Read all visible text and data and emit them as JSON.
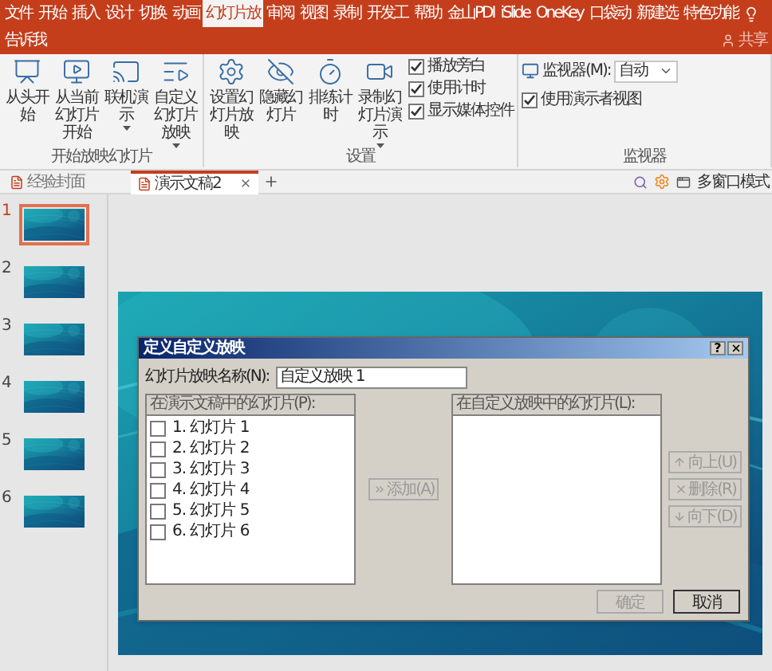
{
  "menu_tabs": [
    {
      "label": "文件",
      "selected": false
    },
    {
      "label": "开始",
      "selected": false
    },
    {
      "label": "插入",
      "selected": false
    },
    {
      "label": "设计",
      "selected": false
    },
    {
      "label": "切换",
      "selected": false
    },
    {
      "label": "动画",
      "selected": false
    },
    {
      "label": "幻灯片放",
      "selected": true
    },
    {
      "label": "审阅",
      "selected": false
    },
    {
      "label": "视图",
      "selected": false
    },
    {
      "label": "录制",
      "selected": false
    },
    {
      "label": "开发工",
      "selected": false
    },
    {
      "label": "帮助",
      "selected": false
    },
    {
      "label": "金山PDI",
      "selected": false
    },
    {
      "label": "iSlide",
      "selected": false
    },
    {
      "label": "OneKey",
      "selected": false
    },
    {
      "label": "口袋动",
      "selected": false
    },
    {
      "label": "新建选",
      "selected": false
    },
    {
      "label": "特色功能",
      "selected": false
    }
  ],
  "tell_me": "告诉我",
  "share": "共享",
  "ribbon_groups": [
    {
      "label": "开始放映幻灯片",
      "items": [
        {
          "kind": "button",
          "label": "从头开始",
          "dropdown": false
        },
        {
          "kind": "button",
          "label": "从当前幻灯片开始",
          "dropdown": false
        },
        {
          "kind": "button",
          "label": "联机演示",
          "dropdown": true
        },
        {
          "kind": "button",
          "label": "自定义幻灯片放映",
          "dropdown": true
        }
      ]
    },
    {
      "label": "设置",
      "items": [
        {
          "kind": "button",
          "label": "设置幻灯片放映",
          "dropdown": false
        },
        {
          "kind": "button",
          "label": "隐藏幻灯片",
          "dropdown": false
        },
        {
          "kind": "button",
          "label": "排练计时",
          "dropdown": false
        },
        {
          "kind": "button",
          "label": "录制幻灯片演示",
          "dropdown": true
        },
        {
          "kind": "checks",
          "options": [
            {
              "label": "播放旁白",
              "checked": true
            },
            {
              "label": "使用计时",
              "checked": true
            },
            {
              "label": "显示媒体控件",
              "checked": true
            }
          ]
        }
      ]
    },
    {
      "label": "监视器",
      "items": [
        {
          "kind": "select",
          "label": "监视器(M):",
          "value": "自动"
        },
        {
          "kind": "checkbox",
          "label": "使用演示者视图",
          "checked": true
        }
      ]
    }
  ],
  "doc_tabs": [
    {
      "label": "经验封面",
      "selected": false
    },
    {
      "label": "演示文稿2",
      "selected": true
    }
  ],
  "window_mode": "多窗口模式",
  "slides": [
    {
      "number": "1",
      "selected": true
    },
    {
      "number": "2",
      "selected": false
    },
    {
      "number": "3",
      "selected": false
    },
    {
      "number": "4",
      "selected": false
    },
    {
      "number": "5",
      "selected": false
    },
    {
      "number": "6",
      "selected": false
    }
  ],
  "dialog": {
    "title": "定义自定义放映",
    "help": "?",
    "name_label": "幻灯片放映名称(N):",
    "name_value": "自定义放映 1",
    "available": {
      "header": "在演示文稿中的幻灯片(P):",
      "items": [
        {
          "label": "1. 幻灯片 1",
          "checked": false
        },
        {
          "label": "2. 幻灯片 2",
          "checked": false
        },
        {
          "label": "3. 幻灯片 3",
          "checked": false
        },
        {
          "label": "4. 幻灯片 4",
          "checked": false
        },
        {
          "label": "5. 幻灯片 5",
          "checked": false
        },
        {
          "label": "6. 幻灯片 6",
          "checked": false
        }
      ]
    },
    "add_button": {
      "label": "添加(A)",
      "disabled": true
    },
    "custom": {
      "header": "在自定义放映中的幻灯片(L):"
    },
    "move_buttons": [
      {
        "kind": "up",
        "label": "向上(U)",
        "disabled": true
      },
      {
        "kind": "delete",
        "label": "删除(R)",
        "disabled": true
      },
      {
        "kind": "down",
        "label": "向下(D)",
        "disabled": true
      }
    ],
    "ok": {
      "label": "确定",
      "disabled": true
    },
    "cancel": {
      "label": "取消",
      "disabled": false
    }
  }
}
